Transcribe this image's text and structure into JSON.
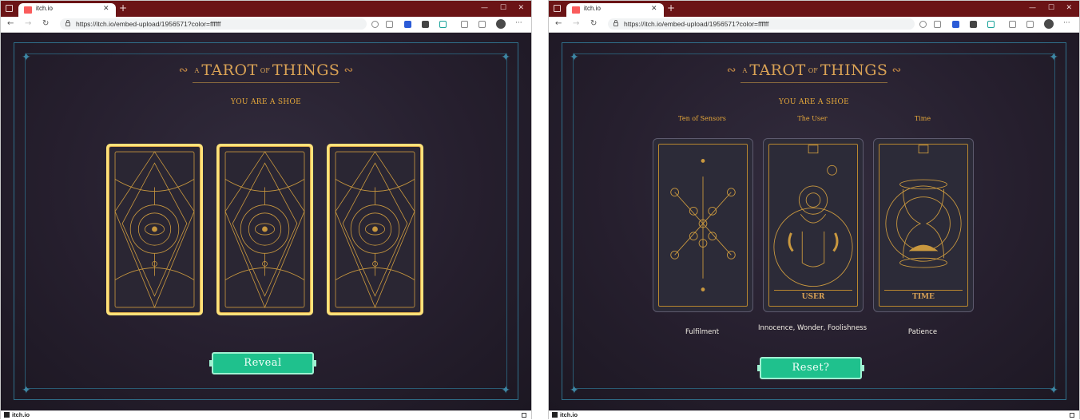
{
  "browser": {
    "tab_title": "itch.io",
    "url": "https://itch.io/embed-upload/1956571?color=ffffff",
    "status_label": "itch.io"
  },
  "game": {
    "title_prefix": "A",
    "title_word1": "TAROT",
    "title_of": "OF",
    "title_word2": "THINGS",
    "result": "YOU ARE A SHOE",
    "reveal_label": "Reveal",
    "reset_label": "Reset?"
  },
  "cards": [
    {
      "name": "Ten of Sensors",
      "meaning": "Fulfilment",
      "face_label": ""
    },
    {
      "name": "The User",
      "meaning": "Innocence, Wonder, Foolishness",
      "face_label": "USER"
    },
    {
      "name": "Time",
      "meaning": "Patience",
      "face_label": "TIME"
    }
  ],
  "icons": {
    "window": "window-icon",
    "favicon": "itchio-favicon",
    "back": "back-arrow-icon",
    "forward": "forward-arrow-icon",
    "reload": "reload-icon",
    "lock": "lock-icon",
    "avatar": "profile-avatar",
    "more": "more-menu-icon"
  },
  "colors": {
    "titlebar": "#6b1416",
    "game_bg": "#261f2e",
    "gold": "#d9a255",
    "frame_teal": "#2f6f8a",
    "button_green": "#1fc18d",
    "card_back_highlight": "#ffe27a"
  }
}
